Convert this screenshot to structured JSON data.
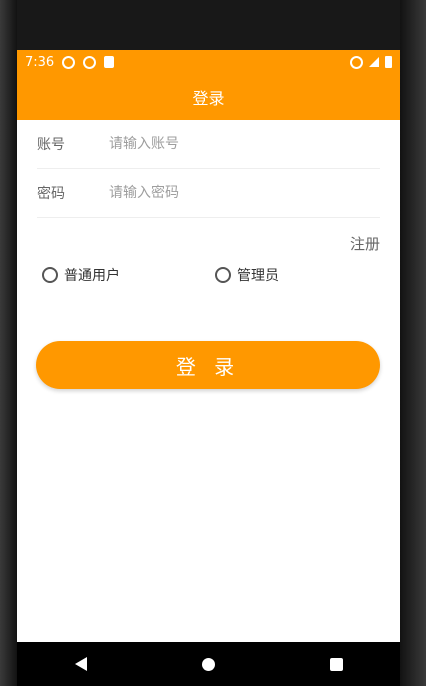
{
  "status_bar": {
    "time": "7:36"
  },
  "appbar": {
    "title": "登录"
  },
  "form": {
    "account_label": "账号",
    "account_placeholder": "请输入账号",
    "password_label": "密码",
    "password_placeholder": "请输入密码",
    "register_link": "注册"
  },
  "role": {
    "options": [
      "普通用户",
      "管理员"
    ]
  },
  "login_button": "登 录",
  "colors": {
    "accent": "#ff9800"
  }
}
